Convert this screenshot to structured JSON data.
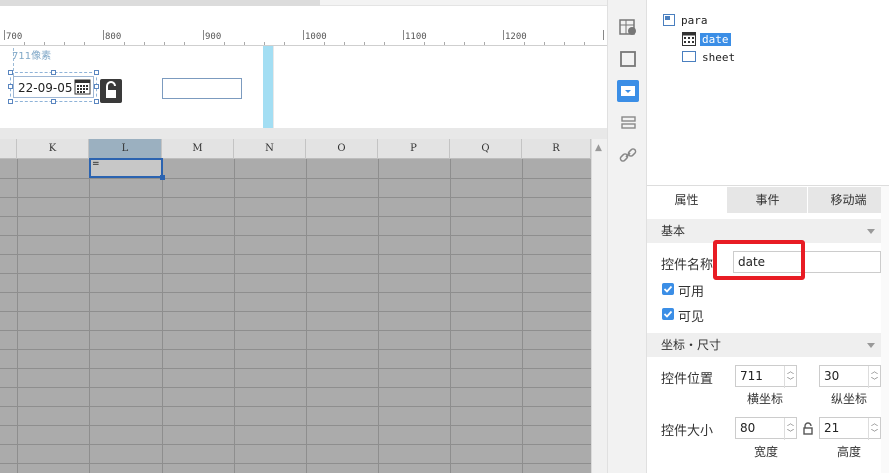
{
  "ruler": {
    "labels": [
      "700",
      "800",
      "900",
      "1000",
      "1100",
      "1200"
    ]
  },
  "canvas": {
    "pixel_label": "711像素",
    "date_widget_value": "22-09-05"
  },
  "grid": {
    "columns": [
      "K",
      "L",
      "M",
      "N",
      "O",
      "P",
      "Q",
      "R"
    ],
    "selected_column": "L",
    "selected_cell_content": "="
  },
  "toolbar": {
    "icons": [
      "widget-settings-icon",
      "square-icon",
      "dropdown-icon",
      "layout-icon",
      "link-icon"
    ],
    "active": "dropdown-icon"
  },
  "tree": {
    "root": "para",
    "children": [
      "date",
      "sheet"
    ],
    "selected": "date"
  },
  "tabs": {
    "properties": "属性",
    "events": "事件",
    "mobile": "移动端",
    "active": "属性"
  },
  "basic": {
    "title": "基本",
    "name_label": "控件名称",
    "name_value": "date",
    "enabled_label": "可用",
    "enabled": true,
    "visible_label": "可见",
    "visible": true
  },
  "coords": {
    "title": "坐标・尺寸",
    "position_label": "控件位置",
    "x_value": "711",
    "y_value": "30",
    "x_caption": "横坐标",
    "y_caption": "纵坐标",
    "size_label": "控件大小",
    "w_value": "80",
    "h_value": "21",
    "w_caption": "宽度",
    "h_caption": "高度"
  },
  "colors": {
    "accent": "#3b8ee6",
    "highlight": "#e81c24",
    "grid_bg": "#ababab",
    "guide": "#a3def3"
  }
}
